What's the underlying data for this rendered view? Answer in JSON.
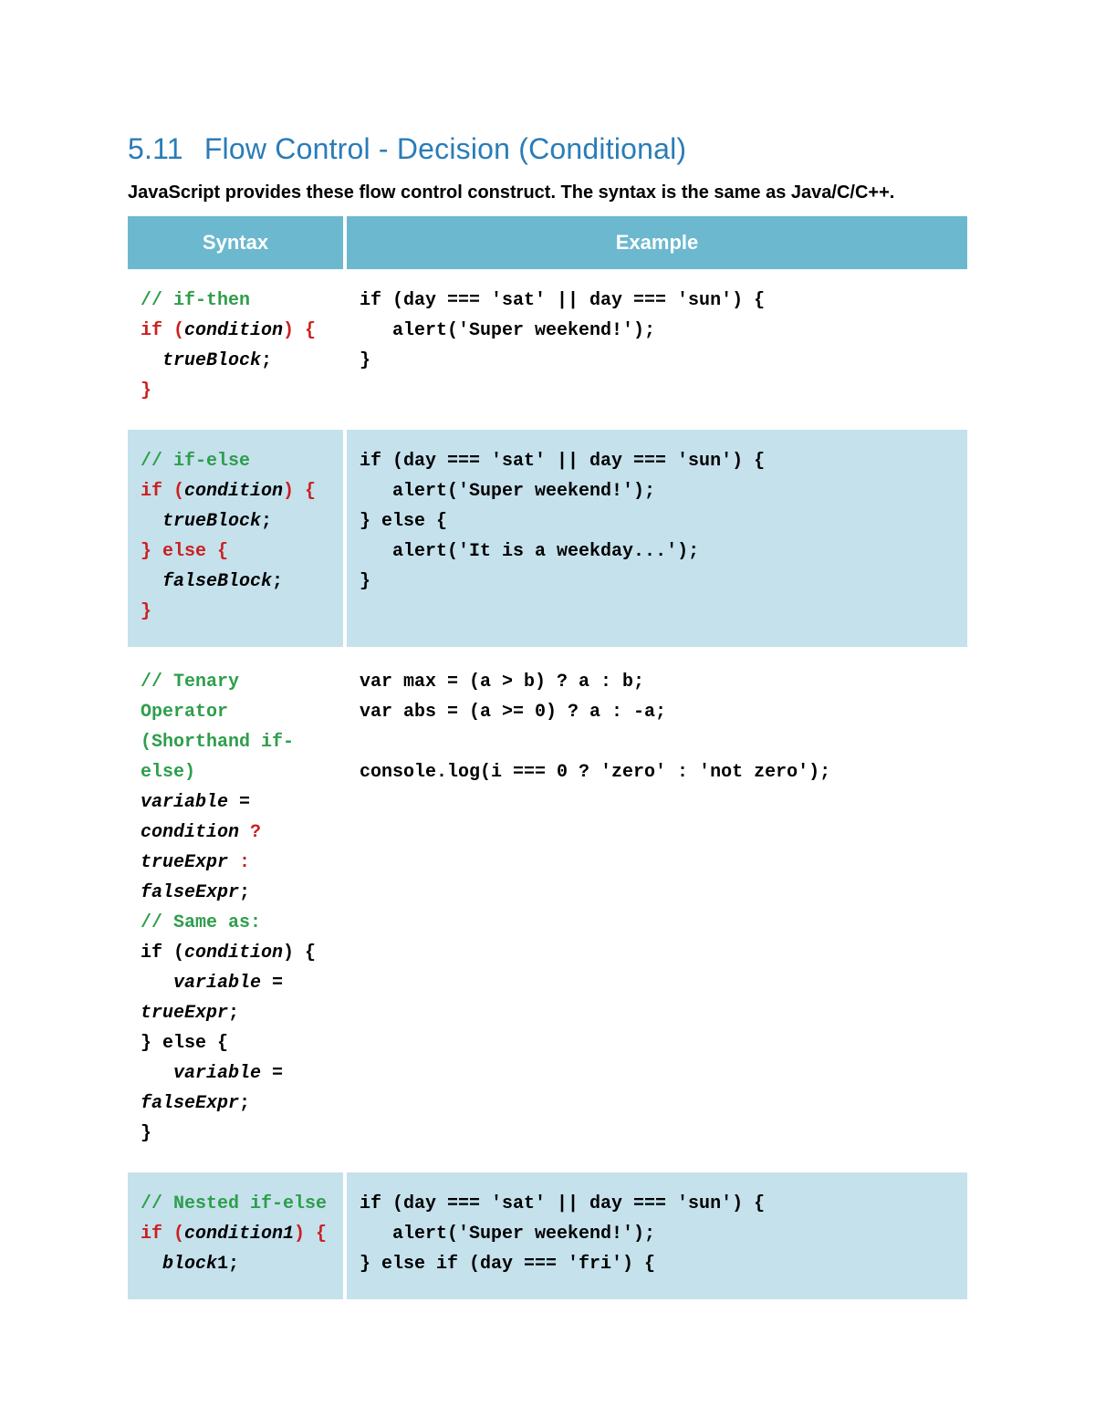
{
  "heading": {
    "number": "5.11",
    "title": "Flow Control - Decision (Conditional)"
  },
  "lead": "JavaScript provides these flow control construct. The syntax is the same as Java/C/C++.",
  "table": {
    "headers": {
      "syntax": "Syntax",
      "example": "Example"
    },
    "rows": [
      {
        "syntax": [
          {
            "cls": "code-comment",
            "t": "// if-then"
          },
          {
            "t": "\n"
          },
          {
            "cls": "code-key",
            "t": "if ("
          },
          {
            "cls": "code-italic",
            "t": "condition"
          },
          {
            "cls": "code-key",
            "t": ") {"
          },
          {
            "t": "\n  "
          },
          {
            "cls": "code-italic",
            "t": "trueBlock"
          },
          {
            "t": ";\n"
          },
          {
            "cls": "code-key",
            "t": "}"
          }
        ],
        "example": "if (day === 'sat' || day === 'sun') {\n   alert('Super weekend!');\n}"
      },
      {
        "syntax": [
          {
            "cls": "code-comment",
            "t": "// if-else"
          },
          {
            "t": "\n"
          },
          {
            "cls": "code-key",
            "t": "if ("
          },
          {
            "cls": "code-italic",
            "t": "condition"
          },
          {
            "cls": "code-key",
            "t": ") {"
          },
          {
            "t": "\n  "
          },
          {
            "cls": "code-italic",
            "t": "trueBlock"
          },
          {
            "t": ";\n"
          },
          {
            "cls": "code-key",
            "t": "} else {"
          },
          {
            "t": "\n  "
          },
          {
            "cls": "code-italic",
            "t": "falseBlock"
          },
          {
            "t": ";\n"
          },
          {
            "cls": "code-key",
            "t": "}"
          }
        ],
        "example": "if (day === 'sat' || day === 'sun') {\n   alert('Super weekend!');\n} else {\n   alert('It is a weekday...');\n}"
      },
      {
        "syntax": [
          {
            "cls": "code-comment",
            "t": "// Tenary Operator (Shorthand if-else)"
          },
          {
            "t": "\n"
          },
          {
            "cls": "code-italic",
            "t": "variable"
          },
          {
            "t": " = "
          },
          {
            "cls": "code-italic",
            "t": "condition"
          },
          {
            "t": " "
          },
          {
            "cls": "code-key",
            "t": "?"
          },
          {
            "t": " "
          },
          {
            "cls": "code-italic",
            "t": "trueExpr"
          },
          {
            "t": " "
          },
          {
            "cls": "code-key",
            "t": ":"
          },
          {
            "t": " "
          },
          {
            "cls": "code-italic",
            "t": "falseExpr"
          },
          {
            "t": ";\n"
          },
          {
            "cls": "code-comment",
            "t": "// Same as:"
          },
          {
            "t": "\nif ("
          },
          {
            "cls": "code-italic",
            "t": "condition"
          },
          {
            "t": ") {\n   "
          },
          {
            "cls": "code-italic",
            "t": "variable"
          },
          {
            "t": " = "
          },
          {
            "cls": "code-italic",
            "t": "trueExpr"
          },
          {
            "t": ";\n} else {\n   "
          },
          {
            "cls": "code-italic",
            "t": "variable"
          },
          {
            "t": " = "
          },
          {
            "cls": "code-italic",
            "t": "falseExpr"
          },
          {
            "t": ";\n}"
          }
        ],
        "example": "var max = (a > b) ? a : b;\nvar abs = (a >= 0) ? a : -a;\n\nconsole.log(i === 0 ? 'zero' : 'not zero');"
      },
      {
        "syntax": [
          {
            "cls": "code-comment",
            "t": "// Nested if-else"
          },
          {
            "t": "\n"
          },
          {
            "cls": "code-key",
            "t": "if ("
          },
          {
            "cls": "code-italic",
            "t": "condition1"
          },
          {
            "cls": "code-key",
            "t": ") {"
          },
          {
            "t": "\n  "
          },
          {
            "cls": "code-italic",
            "t": "block"
          },
          {
            "t": "1;"
          }
        ],
        "example": "if (day === 'sat' || day === 'sun') {\n   alert('Super weekend!');\n} else if (day === 'fri') {"
      }
    ]
  }
}
